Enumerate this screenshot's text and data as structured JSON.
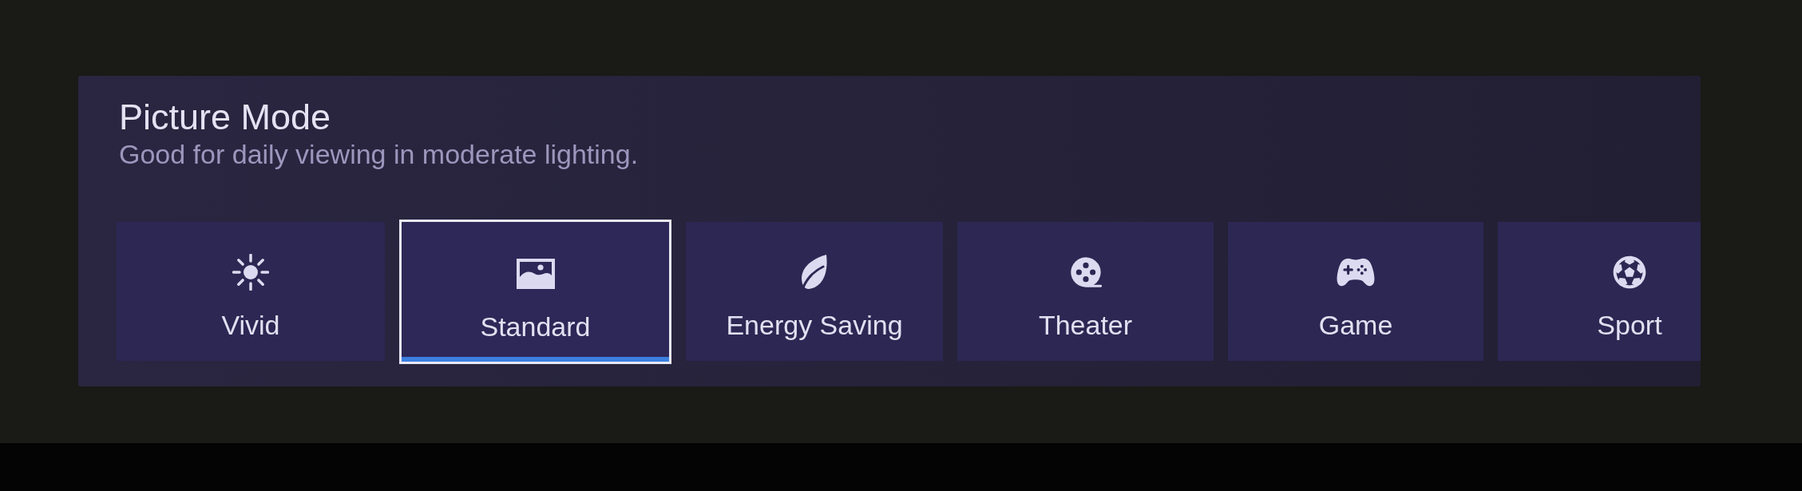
{
  "panel": {
    "title": "Picture Mode",
    "description": "Good for daily viewing in moderate lighting."
  },
  "modes": [
    {
      "label": "Vivid",
      "selected": false
    },
    {
      "label": "Standard",
      "selected": true
    },
    {
      "label": "Energy Saving",
      "selected": false
    },
    {
      "label": "Theater",
      "selected": false
    },
    {
      "label": "Game",
      "selected": false
    },
    {
      "label": "Sport",
      "selected": false
    }
  ]
}
